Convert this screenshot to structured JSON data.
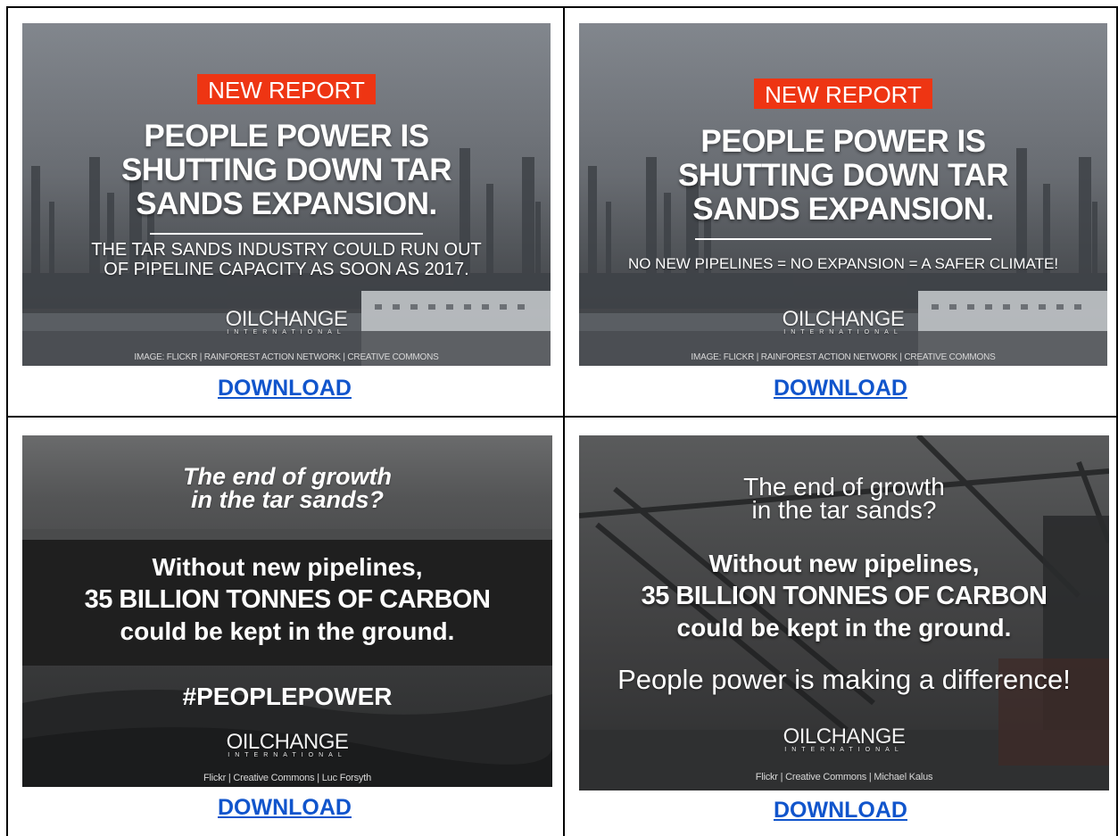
{
  "cards": [
    {
      "tag": "NEW REPORT",
      "headline": [
        "PEOPLE POWER IS",
        "SHUTTING DOWN TAR",
        "SANDS EXPANSION."
      ],
      "subtext": [
        "THE TAR SANDS INDUSTRY COULD RUN OUT",
        "OF PIPELINE CAPACITY AS SOON AS 2017."
      ],
      "logo_main": "OILCHANGE",
      "logo_sub": "INTERNATIONAL",
      "credit": "IMAGE: FLICKR | RAINFOREST ACTION NETWORK | CREATIVE COMMONS",
      "download_label": "DOWNLOAD"
    },
    {
      "tag": "NEW REPORT",
      "headline": [
        "PEOPLE POWER IS",
        "SHUTTING DOWN TAR",
        "SANDS EXPANSION."
      ],
      "subtext": [
        "NO NEW PIPELINES = NO EXPANSION = A SAFER CLIMATE!"
      ],
      "logo_main": "OILCHANGE",
      "logo_sub": "INTERNATIONAL",
      "credit": "IMAGE: FLICKR | RAINFOREST ACTION NETWORK | CREATIVE COMMONS",
      "download_label": "DOWNLOAD"
    },
    {
      "question": [
        "The end of growth",
        "in the tar sands?"
      ],
      "statement": [
        "Without new pipelines,",
        "35 BILLION TONNES OF CARBON",
        "could be kept in the ground."
      ],
      "hashtag": "#PEOPLEPOWER",
      "logo_main": "OILCHANGE",
      "logo_sub": "INTERNATIONAL",
      "credit": "Flickr | Creative Commons | Luc Forsyth",
      "download_label": "DOWNLOAD"
    },
    {
      "question": [
        "The end of growth",
        "in the tar sands?"
      ],
      "statement": [
        "Without new pipelines,",
        "35 BILLION TONNES OF CARBON",
        "could be kept in the ground."
      ],
      "tagline": "People power is making a difference!",
      "logo_main": "OILCHANGE",
      "logo_sub": "INTERNATIONAL",
      "credit": "Flickr | Creative Commons | Michael Kalus",
      "download_label": "DOWNLOAD"
    }
  ],
  "colors": {
    "tag_red": "#ee3513",
    "link_blue": "#1155cc",
    "border": "#000000"
  }
}
